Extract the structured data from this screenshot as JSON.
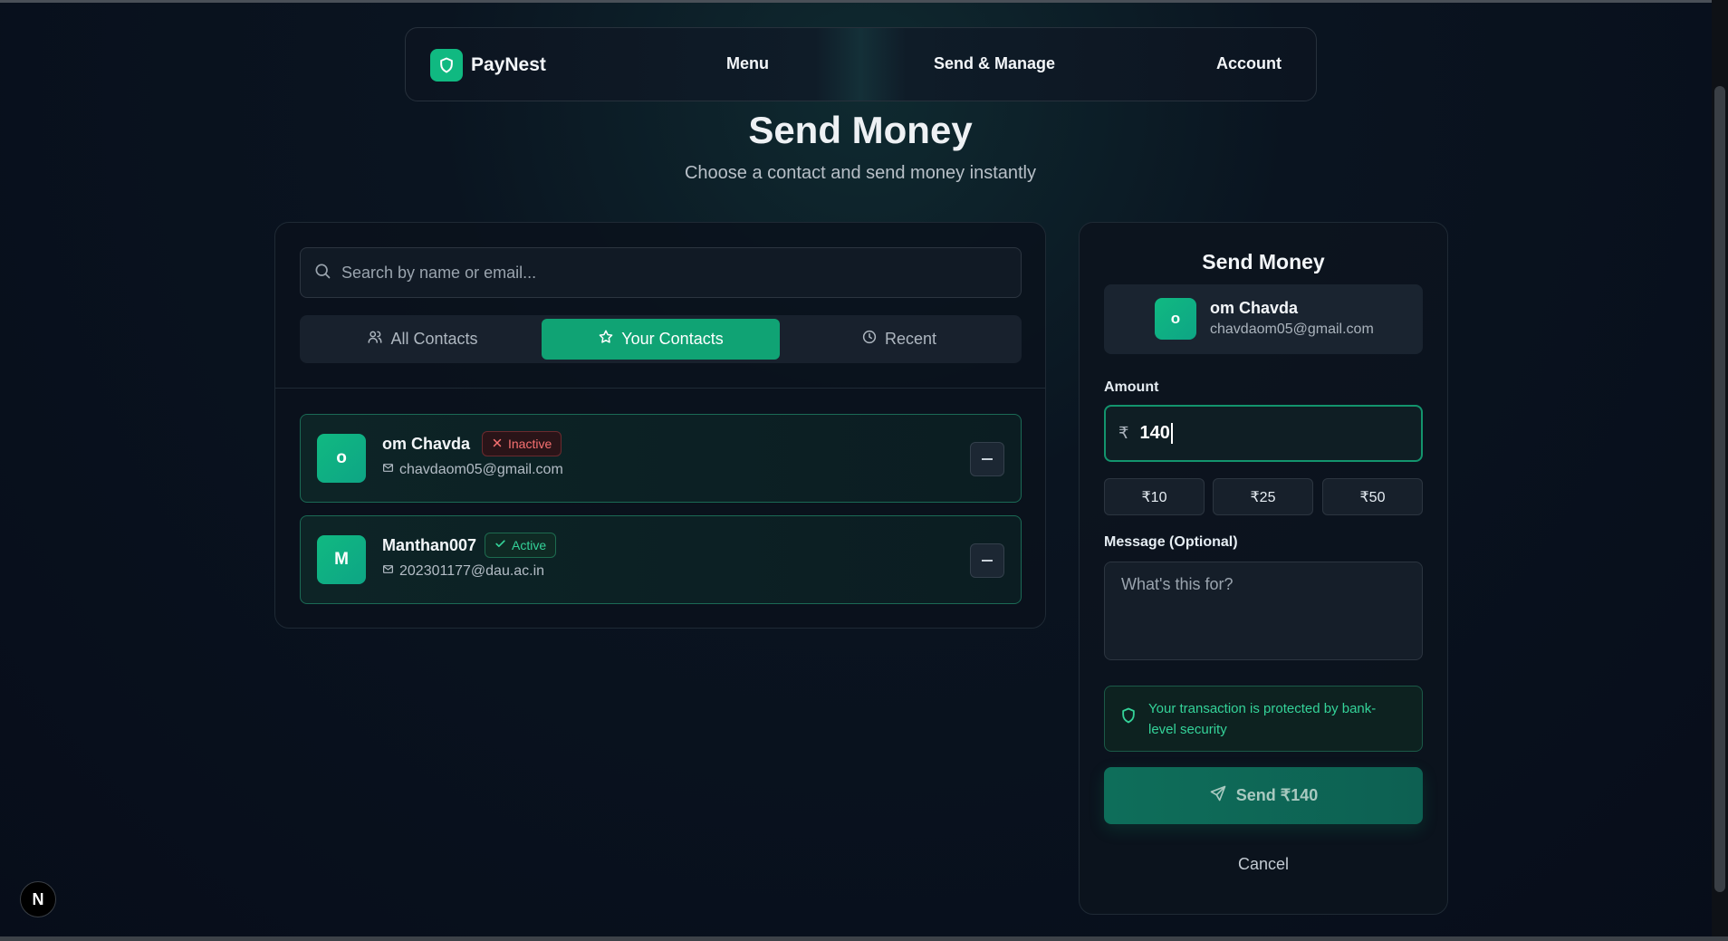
{
  "nav": {
    "brand": "PayNest",
    "links": [
      "Menu",
      "Send & Manage",
      "Account"
    ]
  },
  "page": {
    "title": "Send Money",
    "subtitle": "Choose a contact and send money instantly"
  },
  "search": {
    "placeholder": "Search by name or email..."
  },
  "tabs": [
    {
      "label": "All Contacts",
      "icon": "users-icon"
    },
    {
      "label": "Your Contacts",
      "icon": "star-icon",
      "active": true
    },
    {
      "label": "Recent",
      "icon": "clock-icon"
    }
  ],
  "contacts": [
    {
      "initial": "o",
      "name": "om Chavda",
      "status": "Inactive",
      "email": "chavdaom05@gmail.com"
    },
    {
      "initial": "M",
      "name": "Manthan007",
      "status": "Active",
      "email": "202301177@dau.ac.in"
    }
  ],
  "send_panel": {
    "title": "Send Money",
    "recipient": {
      "initial": "o",
      "name": "om Chavda",
      "email": "chavdaom05@gmail.com"
    },
    "amount_label": "Amount",
    "currency_symbol": "₹",
    "amount_value": "140",
    "quick_amounts": [
      "₹10",
      "₹25",
      "₹50"
    ],
    "message_label": "Message (Optional)",
    "message_placeholder": "What's this for?",
    "security_note": "Your transaction is protected by bank-level security",
    "send_label": "Send ₹140",
    "cancel_label": "Cancel"
  },
  "dev_badge": "N",
  "colors": {
    "accent": "#10b981",
    "inactive": "#f87171",
    "active": "#34d399",
    "background": "#070d1a"
  }
}
